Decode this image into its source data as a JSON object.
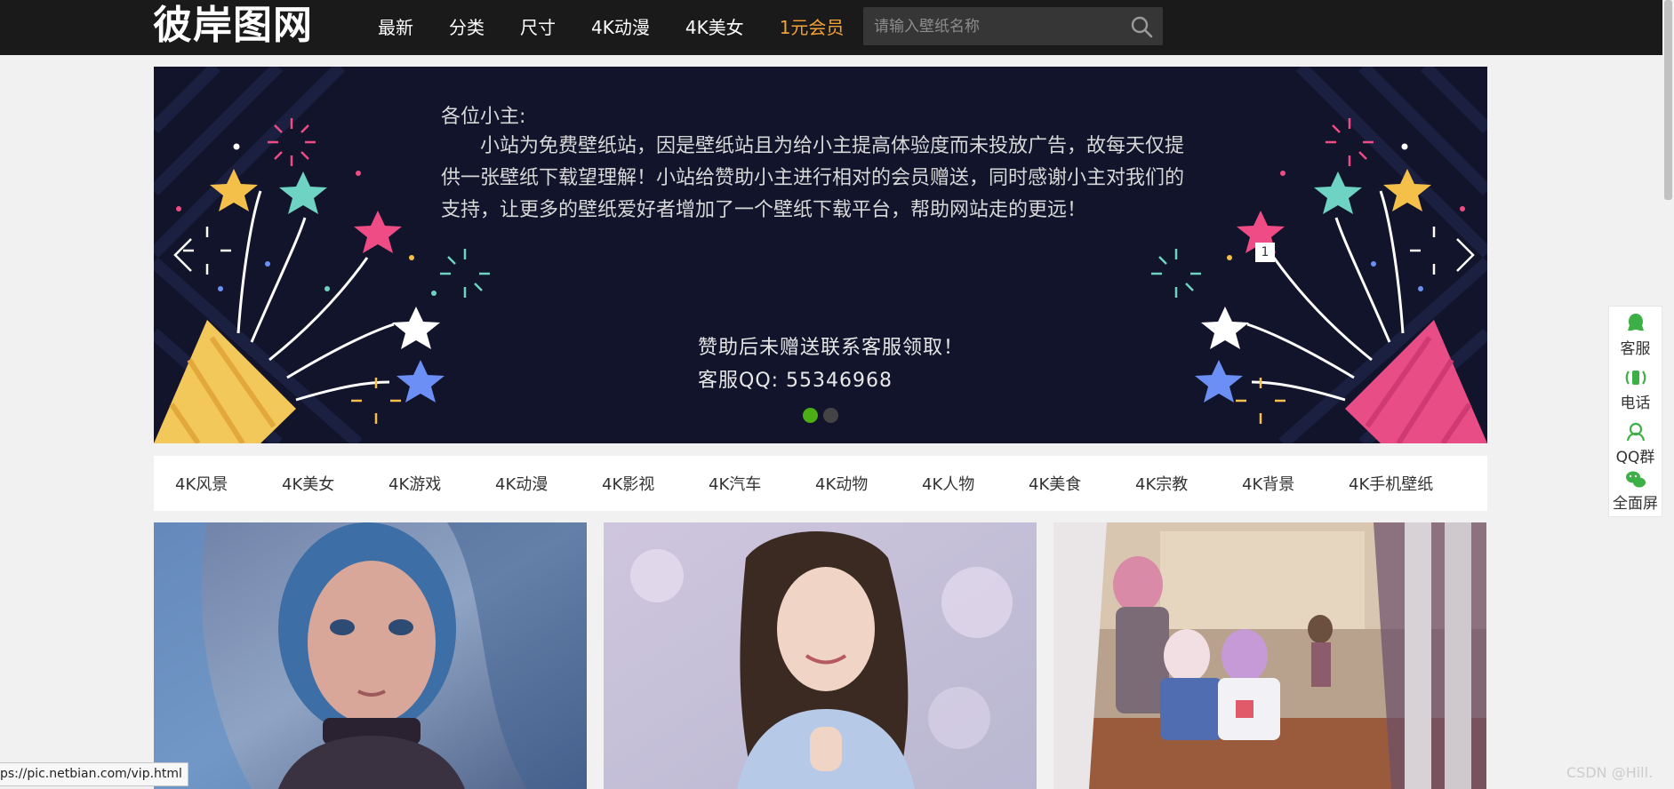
{
  "header": {
    "logo_text": "彼岸图网",
    "nav": [
      {
        "label": "最新"
      },
      {
        "label": "分类"
      },
      {
        "label": "尺寸"
      },
      {
        "label": "4K动漫"
      },
      {
        "label": "4K美女"
      },
      {
        "label": "1元会员",
        "highlight_color": "#f3a236"
      }
    ],
    "search": {
      "placeholder": "请输入壁纸名称",
      "value": ""
    }
  },
  "banner": {
    "greeting": "各位小主:",
    "paragraph": "小站为免费壁纸站，因是壁纸站且为给小主提高体验度而未投放广告，故每天仅提供一张壁纸下载望理解！小站给赞助小主进行相对的会员赠送，同时感谢小主对我们的支持，让更多的壁纸爱好者增加了一个壁纸下载平台，帮助网站走的更远！",
    "line1": "赞助后未赠送联系客服领取！",
    "line2": "客服QQ: 55346968",
    "slide_badge": "1",
    "dots": [
      {
        "active": true
      },
      {
        "active": false
      }
    ],
    "active_dot_color": "#4cae14"
  },
  "categories": [
    "4K风景",
    "4K美女",
    "4K游戏",
    "4K动漫",
    "4K影视",
    "4K汽车",
    "4K动物",
    "4K人物",
    "4K美食",
    "4K宗教",
    "4K背景",
    "4K手机壁纸"
  ],
  "gallery": [
    {
      "icon": "anime-girl-blue-hair-image"
    },
    {
      "icon": "woman-portrait-photo-image"
    },
    {
      "icon": "anime-group-classroom-image"
    }
  ],
  "side_panel": [
    {
      "label": "客服",
      "icon": "customer-service-icon"
    },
    {
      "label": "电话",
      "icon": "phone-icon"
    },
    {
      "label": "QQ群",
      "icon": "qq-group-icon"
    },
    {
      "label": "全面屏",
      "icon": "wechat-icon"
    }
  ],
  "status_url": "ps://pic.netbian.com/vip.html",
  "watermark": "CSDN @Hill."
}
